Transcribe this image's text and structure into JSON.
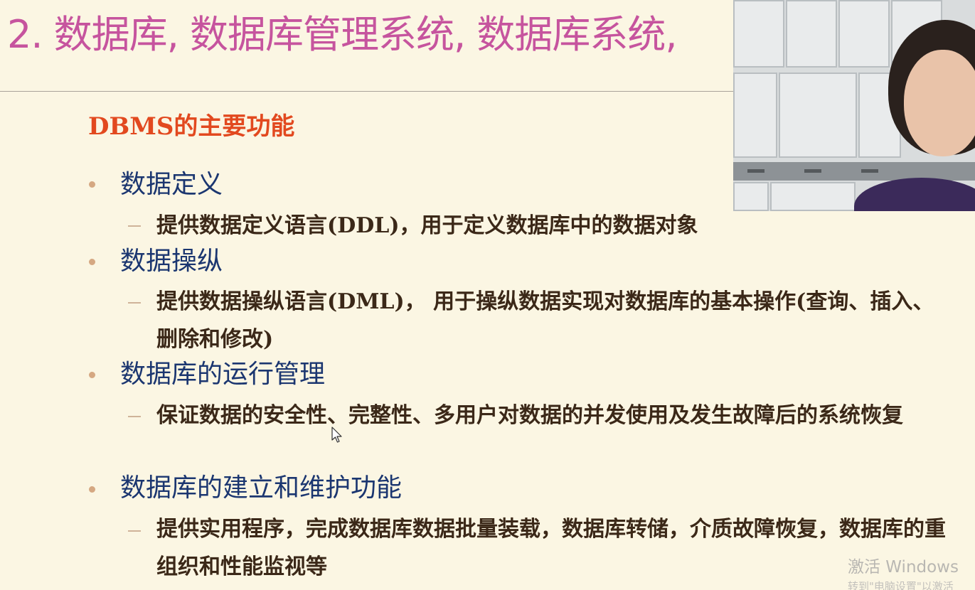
{
  "slide": {
    "title": "2. 数据库, 数据库管理系统, 数据库系统,",
    "heading": "DBMS的主要功能",
    "items": [
      {
        "label": "数据定义",
        "desc": "提供数据定义语言(DDL)，用于定义数据库中的数据对象"
      },
      {
        "label": "数据操纵",
        "desc": "提供数据操纵语言(DML)， 用于操纵数据实现对数据库的基本操作(查询、插入、删除和修改)"
      },
      {
        "label": "数据库的运行管理",
        "desc": "保证数据的安全性、完整性、多用户对数据的并发使用及发生故障后的系统恢复"
      },
      {
        "label": "数据库的建立和维护功能",
        "desc": "提供实用程序，完成数据库数据批量装载，数据库转储，介质故障恢复，数据库的重组织和性能监视等"
      }
    ]
  },
  "watermark": {
    "line1": "激活 Windows",
    "line2": "转到\"电脑设置\"以激活"
  },
  "colors": {
    "title": "#c6549e",
    "heading": "#e2491f",
    "bullet_text": "#1b3670",
    "body_text": "#3b2818",
    "background": "#fbf6e3"
  },
  "icons": {
    "cursor": "arrow-cursor-icon",
    "webcam": "webcam-overlay"
  }
}
